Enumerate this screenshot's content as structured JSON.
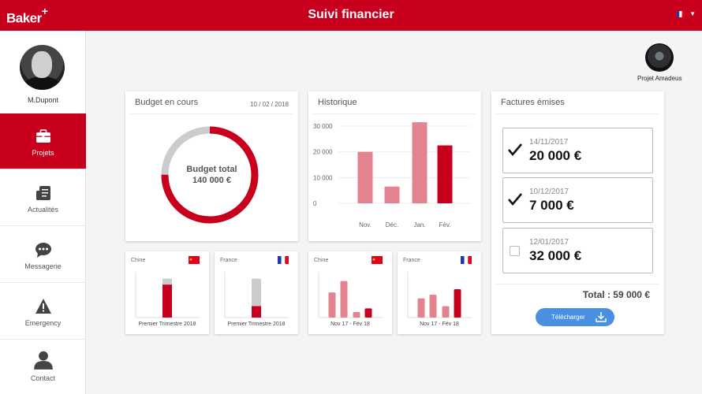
{
  "header": {
    "logo": "Baker",
    "logo_plus": "+",
    "title": "Suivi financier",
    "language_flag": "flag-france-icon"
  },
  "sidebar": {
    "user_name": "M.Dupont",
    "items": [
      {
        "label": "Projets",
        "icon": "briefcase-icon",
        "active": true
      },
      {
        "label": "Actualités",
        "icon": "news-icon",
        "active": false
      },
      {
        "label": "Messagerie",
        "icon": "chat-bubble-icon",
        "active": false
      },
      {
        "label": "Emergency",
        "icon": "warning-icon",
        "active": false
      },
      {
        "label": "Contact",
        "icon": "person-icon",
        "active": false
      }
    ]
  },
  "project": {
    "name": "Projet Amadeus"
  },
  "budget": {
    "title": "Budget en cours",
    "date": "10 / 02 / 2018",
    "label": "Budget total",
    "amount": "140 000 €",
    "spent_fraction": 0.75
  },
  "historique": {
    "title": "Historique",
    "chart_data": {
      "type": "bar",
      "categories": [
        "Nov.",
        "Déc.",
        "Jan.",
        "Fév."
      ],
      "values": [
        20000,
        6500,
        31500,
        22500
      ],
      "ticks": [
        "30 000",
        "20 000",
        "10 000",
        "0"
      ],
      "tick_values": [
        30000,
        20000,
        10000,
        0
      ],
      "ylim": [
        0,
        30000
      ],
      "colors": [
        "#e3838f",
        "#e3838f",
        "#e3838f",
        "#c8001e"
      ]
    }
  },
  "factures": {
    "title": "Factures émises",
    "items": [
      {
        "date": "14/11/2017",
        "amount": "20 000 €",
        "checked": true
      },
      {
        "date": "10/12/2017",
        "amount": "7 000 €",
        "checked": true
      },
      {
        "date": "12/01/2017",
        "amount": "32 000 €",
        "checked": false
      }
    ],
    "total": "Total : 59 000 €",
    "download_label": "Télécharger"
  },
  "mini_charts": [
    {
      "country": "Chine",
      "flag": "flag-china-icon",
      "footer": "Premier Trimestre 2018",
      "chart_data": {
        "type": "bar",
        "stacked": true,
        "values_total": [
          0.85
        ],
        "values_filled": [
          0.72
        ]
      }
    },
    {
      "country": "France",
      "flag": "flag-france-icon",
      "footer": "Premier Trimestre 2018",
      "chart_data": {
        "type": "bar",
        "stacked": true,
        "values_total": [
          0.85
        ],
        "values_filled": [
          0.25
        ]
      }
    },
    {
      "country": "Chine",
      "flag": "flag-china-icon",
      "footer": "Nov 17 - Fév 18",
      "chart_data": {
        "type": "bar",
        "values": [
          0.55,
          0.8,
          0.12,
          0.2
        ],
        "colors": [
          "#e3838f",
          "#e3838f",
          "#e3838f",
          "#c8001e"
        ]
      }
    },
    {
      "country": "France",
      "flag": "flag-france-icon",
      "footer": "Nov 17 - Fév 18",
      "chart_data": {
        "type": "bar",
        "values": [
          0.42,
          0.5,
          0.25,
          0.62
        ],
        "colors": [
          "#e3838f",
          "#e3838f",
          "#e3838f",
          "#c8001e"
        ]
      }
    }
  ],
  "colors": {
    "brand": "#c8001e",
    "light_bar": "#e3838f",
    "grey_bar": "#cccccc",
    "button": "#4a90e2"
  }
}
